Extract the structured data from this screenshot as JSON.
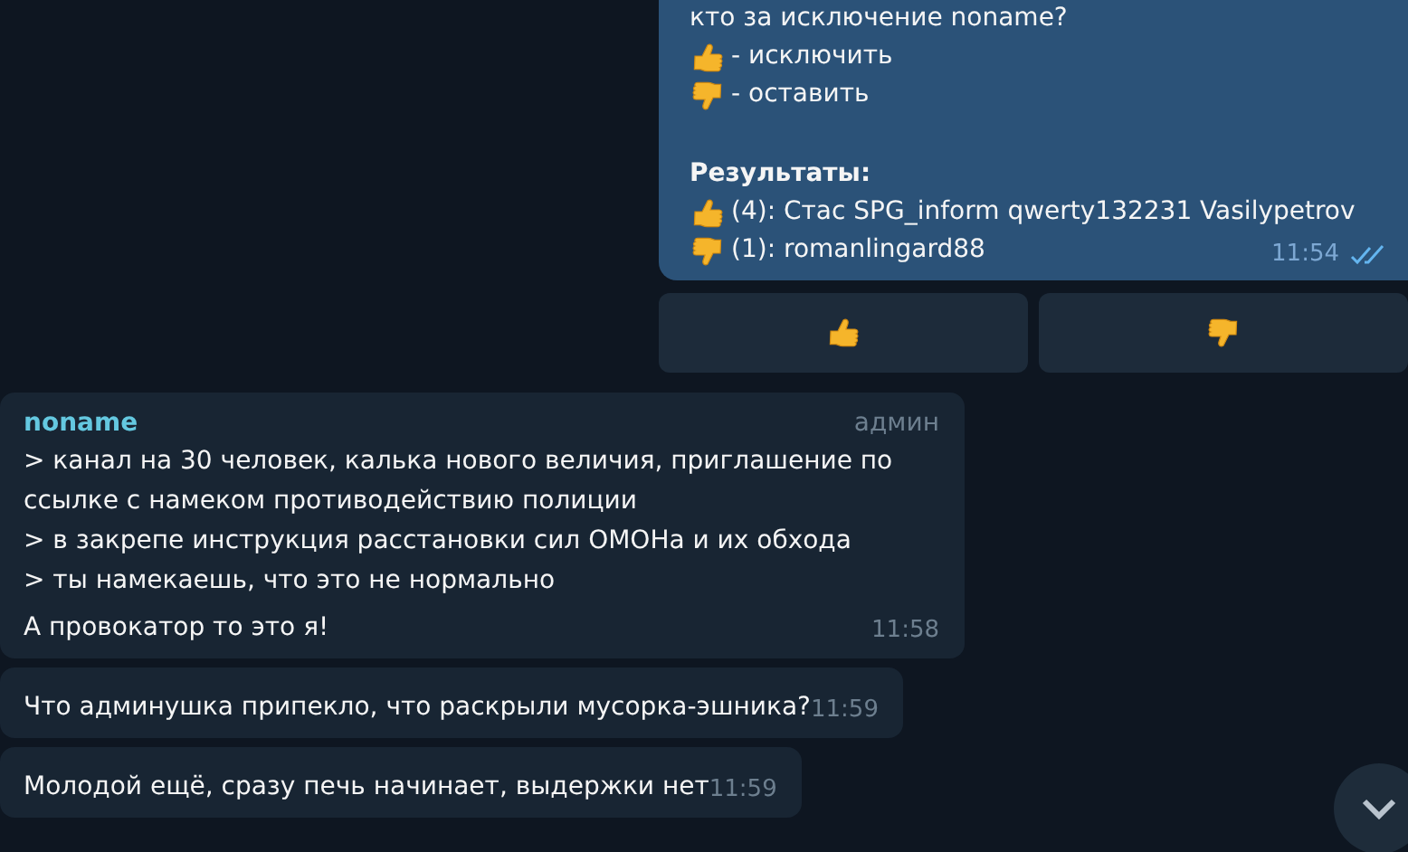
{
  "outgoing_poll": {
    "lines": [
      {
        "kind": "text",
        "text": "кто за исключение noname?"
      },
      {
        "kind": "approve",
        "text": "- исключить"
      },
      {
        "kind": "reject",
        "text": "- оставить"
      },
      {
        "kind": "blank"
      },
      {
        "kind": "heading",
        "text": "Результаты:"
      },
      {
        "kind": "approve",
        "text": "(4): Стас SPG_inform qwerty132231 Vasilypetrov"
      },
      {
        "kind": "reject",
        "text": "(1): romanlingard88"
      }
    ],
    "time": "11:54",
    "read": true,
    "buttons": [
      {
        "kind": "approve"
      },
      {
        "kind": "reject"
      }
    ]
  },
  "messages": [
    {
      "sender": "noname",
      "role": "админ",
      "lines": [
        "> канал на 30 человек, калька нового величия, приглашение по ссылке с намеком противодействию полиции",
        "> в закрепе инструкция расстановки сил ОМОНа и их обхода",
        "> ты намекаешь, что это не нормально",
        "А провокатор то это я!"
      ],
      "time": "11:58"
    },
    {
      "lines": [
        "Что админушка припекло, что раскрыли мусорка-эшника?"
      ],
      "time": "11:59"
    },
    {
      "lines": [
        "Молодой ещё, сразу печь начинает, выдержки нет"
      ],
      "time": "11:59"
    }
  ]
}
